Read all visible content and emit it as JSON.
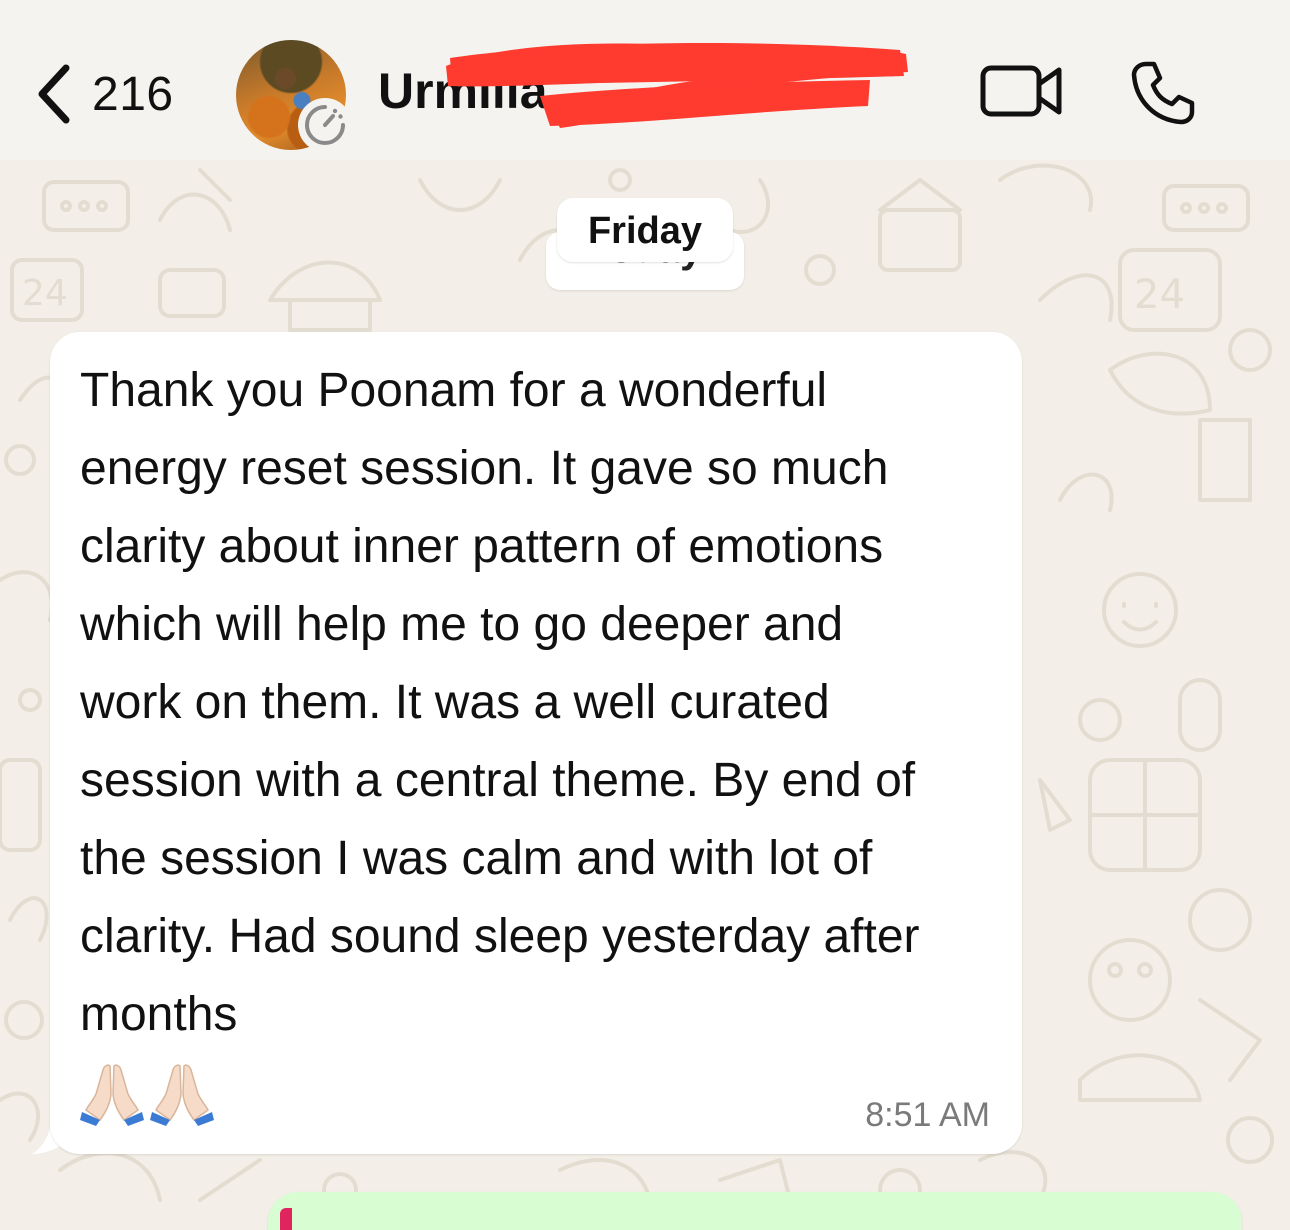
{
  "header": {
    "back_count": "216",
    "contact_name": "Urmilla",
    "icons": [
      "chevron-left-icon",
      "status-ring-icon",
      "video-camera-icon",
      "phone-icon"
    ]
  },
  "chat": {
    "date_chip": "Friday",
    "date_chip_behind": "Today",
    "message": {
      "text": "Thank you Poonam for a wonderful\nenergy reset session. It gave so much\nclarity about inner pattern of emotions\nwhich will help me to go deeper and\nwork on them. It was a well curated\nsession with a central theme. By end of\nthe session I was calm and with lot of\nclarity. Had sound sleep yesterday after\nmonths",
      "emoji": [
        "🙏🏻",
        "🙏🏻"
      ],
      "time": "8:51 AM"
    }
  },
  "colors": {
    "header_bg": "#f5f3ef",
    "chat_bg": "#f3efe8",
    "bubble_in": "#ffffff",
    "bubble_out": "#d9fdd3",
    "redaction": "#ff3b30"
  }
}
